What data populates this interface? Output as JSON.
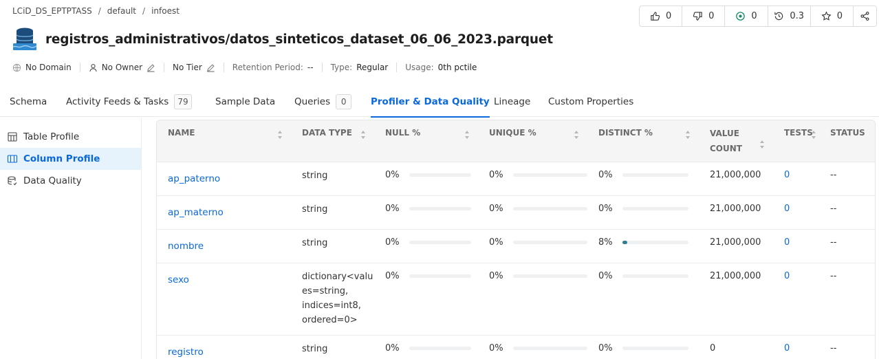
{
  "breadcrumb": [
    "LCiD_DS_EPTPTASS",
    "default",
    "infoest"
  ],
  "stats": {
    "likes": "0",
    "dislikes": "0",
    "watchers": "0",
    "version": "0.3",
    "stars": "0"
  },
  "title": "registros_administrativos/datos_sinteticos_dataset_06_06_2023.parquet",
  "meta": {
    "domain": "No Domain",
    "owner": "No Owner",
    "tier": "No Tier",
    "retention_label": "Retention Period:",
    "retention_value": "--",
    "type_label": "Type:",
    "type_value": "Regular",
    "usage_label": "Usage:",
    "usage_value": "0th pctile"
  },
  "tabs": [
    {
      "label": "Schema"
    },
    {
      "label": "Activity Feeds & Tasks",
      "count": "79"
    },
    {
      "label": "Sample Data"
    },
    {
      "label": "Queries",
      "count": "0"
    },
    {
      "label": "Profiler & Data Quality"
    },
    {
      "label": "Lineage"
    },
    {
      "label": "Custom Properties"
    }
  ],
  "sidebar": [
    "Table Profile",
    "Column Profile",
    "Data Quality"
  ],
  "columns": {
    "name": "NAME",
    "data_type": "DATA TYPE",
    "null": "NULL %",
    "unique": "UNIQUE %",
    "distinct": "DISTINCT %",
    "value_count": "VALUE COUNT",
    "tests": "TESTS",
    "status": "STATUS"
  },
  "rows": [
    {
      "name": "ap_paterno",
      "data_type": "string",
      "null_pct": "0%",
      "null_frac": 0,
      "unique_pct": "0%",
      "unique_frac": 0,
      "distinct_pct": "0%",
      "distinct_frac": 0,
      "value_count": "21,000,000",
      "tests": "0",
      "status": "--"
    },
    {
      "name": "ap_materno",
      "data_type": "string",
      "null_pct": "0%",
      "null_frac": 0,
      "unique_pct": "0%",
      "unique_frac": 0,
      "distinct_pct": "0%",
      "distinct_frac": 0,
      "value_count": "21,000,000",
      "tests": "0",
      "status": "--"
    },
    {
      "name": "nombre",
      "data_type": "string",
      "null_pct": "0%",
      "null_frac": 0,
      "unique_pct": "0%",
      "unique_frac": 0,
      "distinct_pct": "8%",
      "distinct_frac": 0.08,
      "value_count": "21,000,000",
      "tests": "0",
      "status": "--"
    },
    {
      "name": "sexo",
      "data_type": "dictionary<values=string, indices=int8, ordered=0>",
      "null_pct": "0%",
      "null_frac": 0,
      "unique_pct": "0%",
      "unique_frac": 0,
      "distinct_pct": "0%",
      "distinct_frac": 0,
      "value_count": "21,000,000",
      "tests": "0",
      "status": "--"
    },
    {
      "name": "registro",
      "data_type": "string",
      "null_pct": "0%",
      "null_frac": 0,
      "unique_pct": "0%",
      "unique_frac": 0,
      "distinct_pct": "0%",
      "distinct_frac": 0,
      "value_count": "0",
      "tests": "0",
      "status": "--"
    }
  ]
}
